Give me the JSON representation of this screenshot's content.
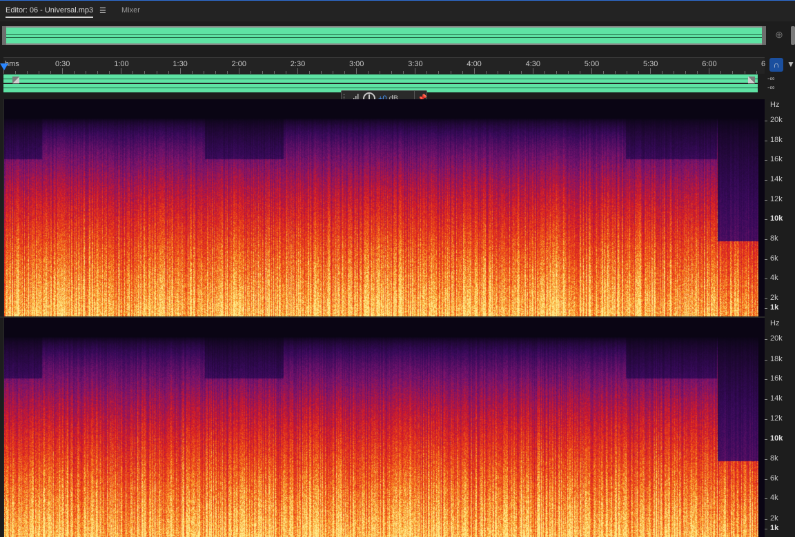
{
  "tabs": {
    "editor_label": "Editor: 06 - Universal.mp3",
    "mixer_label": "Mixer"
  },
  "ruler": {
    "start_label": "hms",
    "labels": [
      "0:30",
      "1:00",
      "1:30",
      "2:00",
      "2:30",
      "3:00",
      "3:30",
      "4:00",
      "4:30",
      "5:00",
      "5:30",
      "6:00",
      "6"
    ]
  },
  "hud": {
    "gain_value": "+0",
    "gain_unit": "dB"
  },
  "mini_wave": {
    "db_top": "-∞",
    "db_bottom": "-∞"
  },
  "spectrogram": {
    "unit": "Hz",
    "freq_labels": [
      "20k",
      "18k",
      "16k",
      "14k",
      "12k",
      "10k",
      "8k",
      "6k",
      "4k",
      "2k",
      "1k"
    ]
  },
  "colors": {
    "waveform": "#5ee3a4",
    "accent": "#2a86ff",
    "background": "#1d1d1d"
  }
}
